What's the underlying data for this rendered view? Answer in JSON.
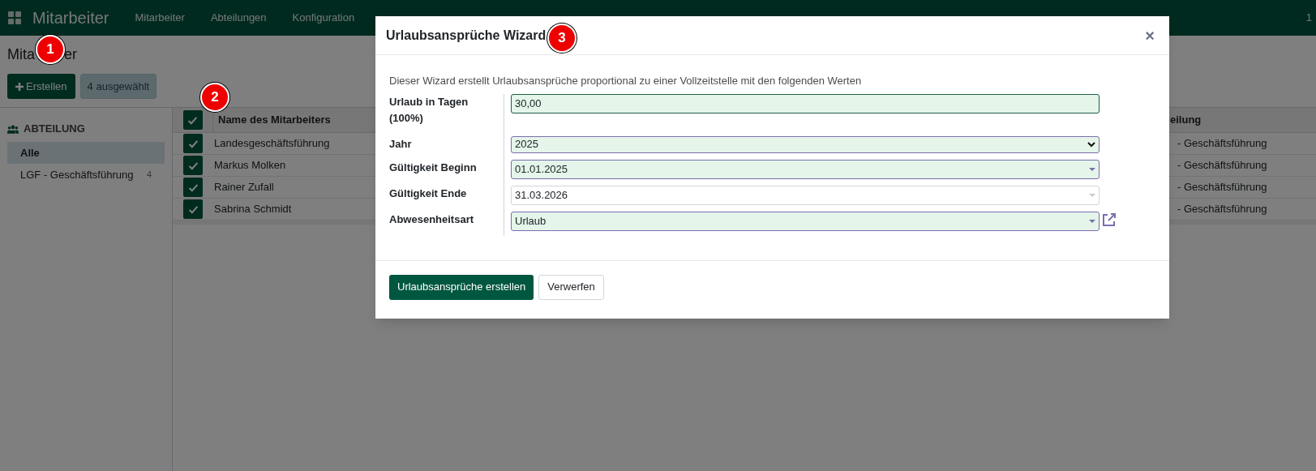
{
  "navbar": {
    "app_title": "Mitarbeiter",
    "menu": [
      "Mitarbeiter",
      "Abteilungen",
      "Konfiguration"
    ],
    "corner_text": "1"
  },
  "page": {
    "title_parts": [
      "Mita",
      "er"
    ],
    "create_button": "Erstellen",
    "selection_badge": "4 ausgewählt"
  },
  "sidebar": {
    "heading": "ABTEILUNG",
    "items": [
      {
        "label": "Alle",
        "selected": true
      },
      {
        "label": "LGF - Geschäftsführung",
        "count": "4",
        "selected": false
      }
    ]
  },
  "table": {
    "header_checked": true,
    "columns": [
      "Name des Mitarbeiters",
      "eilung"
    ],
    "rows": [
      {
        "checked": true,
        "cells": [
          "Landesgeschäftsführung",
          "- Geschäftsführung"
        ]
      },
      {
        "checked": true,
        "cells": [
          "Markus Molken",
          "- Geschäftsführung"
        ]
      },
      {
        "checked": true,
        "cells": [
          "Rainer Zufall",
          "- Geschäftsführung"
        ]
      },
      {
        "checked": true,
        "cells": [
          "Sabrina Schmidt",
          "- Geschäftsführung"
        ]
      }
    ]
  },
  "dialog": {
    "title": "Urlaubsansprüche Wizard",
    "close": "×",
    "description": "Dieser Wizard erstellt Urlaubsansprüche proportional zu einer Vollzeitstelle mit den folgenden Werten",
    "fields": [
      {
        "label": "Urlaub in Tagen (100%)",
        "value": "30,00",
        "kind": "text",
        "required": true,
        "focused": true
      },
      {
        "label": "Jahr",
        "value": "2025",
        "kind": "select",
        "required": true,
        "focused": false
      },
      {
        "label": "Gültigkeit Beginn",
        "value": "01.01.2025",
        "kind": "combo",
        "required": true,
        "focused": false
      },
      {
        "label": "Gültigkeit Ende",
        "value": "31.03.2026",
        "kind": "combo",
        "required": false,
        "focused": false
      },
      {
        "label": "Abwesenheitsart",
        "value": "Urlaub",
        "kind": "link",
        "required": true,
        "focused": false
      }
    ],
    "buttons": [
      {
        "label": "Urlaubsansprüche erstellen",
        "primary": true
      },
      {
        "label": "Verwerfen",
        "primary": false
      }
    ]
  },
  "annotations": [
    "1",
    "2",
    "3"
  ]
}
